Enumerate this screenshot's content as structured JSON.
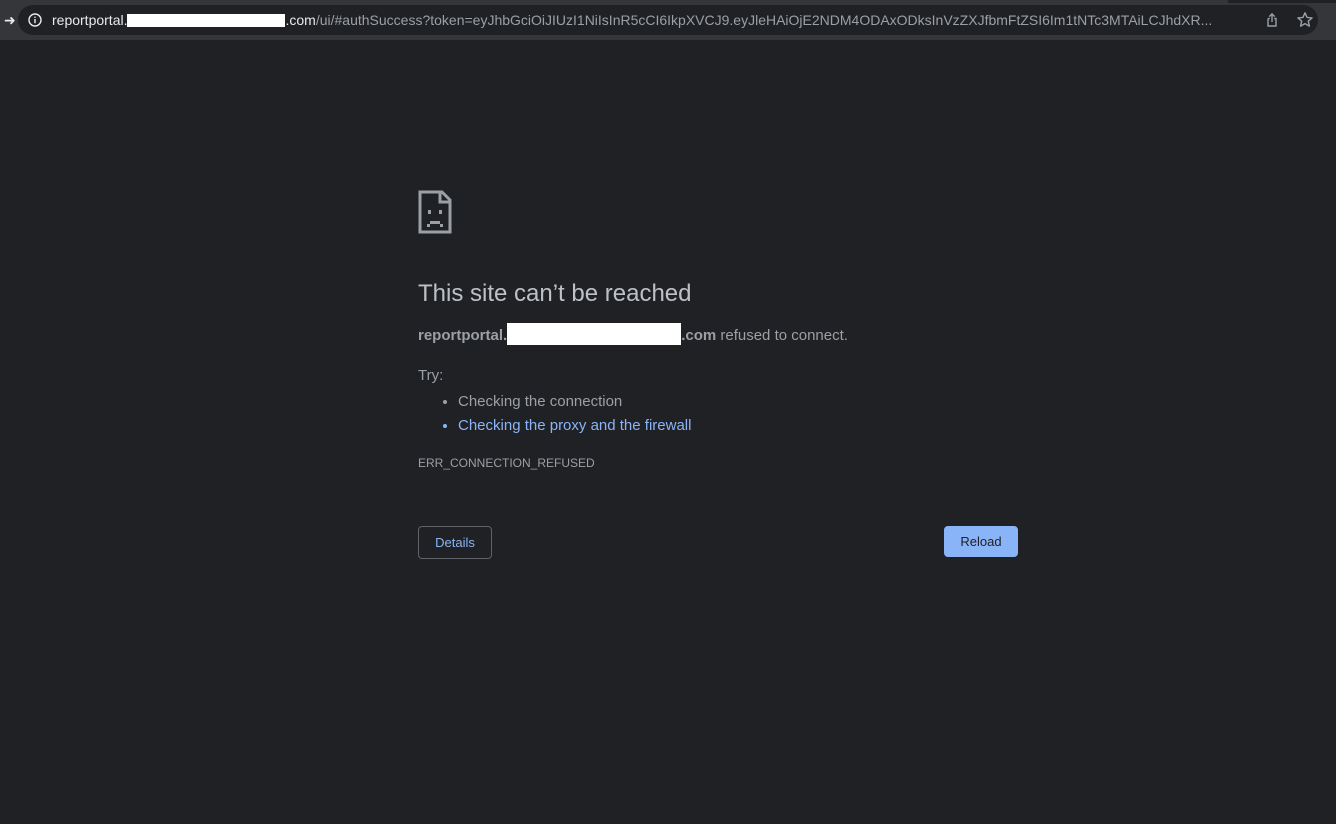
{
  "browser": {
    "url_host_prefix": "reportportal.",
    "url_host_suffix": ".com",
    "url_path": "/ui/#authSuccess?token=eyJhbGciOiJIUzI1NiIsInR5cCI6IkpXVCJ9.eyJleHAiOjE2NDM4ODAxODksInVzZXJfbmFtZSI6Im1tNTc3MTAiLCJhdXR...",
    "icons": {
      "back": "back-arrow-icon",
      "info": "info-icon",
      "share": "share-icon",
      "bookmark": "star-icon"
    }
  },
  "error_page": {
    "icon": "sad-page-icon",
    "title": "This site can’t be reached",
    "host_prefix": "reportportal.",
    "host_suffix": ".com",
    "message": " refused to connect.",
    "try_label": "Try:",
    "suggestions": [
      {
        "text": "Checking the connection",
        "is_link": false
      },
      {
        "text": "Checking the proxy and the firewall",
        "is_link": true
      }
    ],
    "error_code": "ERR_CONNECTION_REFUSED",
    "details_button": "Details",
    "reload_button": "Reload"
  },
  "colors": {
    "background": "#202124",
    "toolbar": "#35363a",
    "text": "#9aa0a6",
    "title": "#bdc1c6",
    "link": "#8ab4f8",
    "primary_button": "#8ab4f8"
  }
}
